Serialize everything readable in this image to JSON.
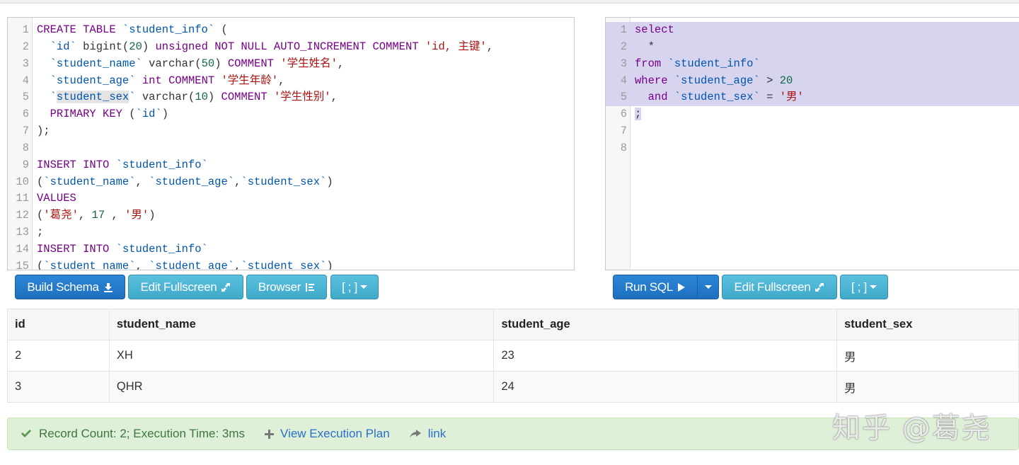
{
  "schema_editor": {
    "lines": [
      {
        "n": "1"
      },
      {
        "n": "2"
      },
      {
        "n": "3"
      },
      {
        "n": "4"
      },
      {
        "n": "5"
      },
      {
        "n": "6"
      },
      {
        "n": "7"
      },
      {
        "n": "8"
      },
      {
        "n": "9"
      },
      {
        "n": "10"
      },
      {
        "n": "11"
      },
      {
        "n": "12"
      },
      {
        "n": "13"
      },
      {
        "n": "14"
      },
      {
        "n": "15"
      }
    ],
    "tokens": {
      "l1": [
        "CREATE TABLE",
        "`student_info`",
        "("
      ],
      "l2": [
        "`id`",
        "bigint",
        "(",
        "20",
        ")",
        "unsigned NOT NULL AUTO_INCREMENT COMMENT",
        "'id, 主键'",
        ","
      ],
      "l3": [
        "`student_name`",
        "varchar",
        "(",
        "50",
        ")",
        "COMMENT",
        "'学生姓名'",
        ","
      ],
      "l4": [
        "`student_age`",
        "int",
        "COMMENT",
        "'学生年龄'",
        ","
      ],
      "l5": [
        "`",
        "student_sex",
        "`",
        "varchar",
        "(",
        "10",
        ")",
        "COMMENT",
        "'学生性别'",
        ","
      ],
      "l6": [
        "PRIMARY KEY",
        "(",
        "`id`",
        ")"
      ],
      "l7": [
        ");"
      ],
      "l9": [
        "INSERT INTO",
        "`student_info`"
      ],
      "l10": [
        "(",
        "`student_name`",
        ",",
        "`student_age`",
        ",",
        "`student_sex`",
        ")"
      ],
      "l11": [
        "VALUES"
      ],
      "l12": [
        "(",
        "'葛尧'",
        ",",
        "17",
        ",",
        "'男'",
        ")"
      ],
      "l13": [
        ";"
      ],
      "l14": [
        "INSERT INTO",
        "`student_info`"
      ],
      "l15": [
        "(",
        "`student_name`",
        ",",
        "`student_age`",
        ",",
        "`student_sex`",
        ")"
      ]
    }
  },
  "query_editor": {
    "lines": [
      {
        "n": "1"
      },
      {
        "n": "2"
      },
      {
        "n": "3"
      },
      {
        "n": "4"
      },
      {
        "n": "5"
      },
      {
        "n": "6"
      },
      {
        "n": "7"
      },
      {
        "n": "8"
      }
    ],
    "tokens": {
      "l1": [
        "select"
      ],
      "l2": [
        "*"
      ],
      "l3": [
        "from",
        "`student_info`"
      ],
      "l4": [
        "where",
        "`student_age`",
        ">",
        "20"
      ],
      "l5": [
        "and",
        "`student_sex`",
        "=",
        "'男'"
      ],
      "l6": [
        ";"
      ]
    }
  },
  "toolbar_left": {
    "build_schema": "Build Schema",
    "edit_fullscreen": "Edit Fullscreen",
    "browser": "Browser",
    "delimiter": "[ ; ]"
  },
  "toolbar_right": {
    "run_sql": "Run SQL",
    "edit_fullscreen": "Edit Fullscreen",
    "delimiter": "[ ; ]"
  },
  "results": {
    "columns": [
      "id",
      "student_name",
      "student_age",
      "student_sex"
    ],
    "rows": [
      [
        "2",
        "XH",
        "23",
        "男"
      ],
      [
        "3",
        "QHR",
        "24",
        "男"
      ]
    ]
  },
  "status": {
    "summary": "Record Count: 2; Execution Time: 3ms",
    "view_plan": "View Execution Plan",
    "link": "link"
  },
  "watermark": "知乎 @葛尧",
  "colors": {
    "primary": "#2b87d6",
    "info": "#5bc0de",
    "success_bg": "#dff0d8",
    "selection": "#d7d4f0"
  }
}
